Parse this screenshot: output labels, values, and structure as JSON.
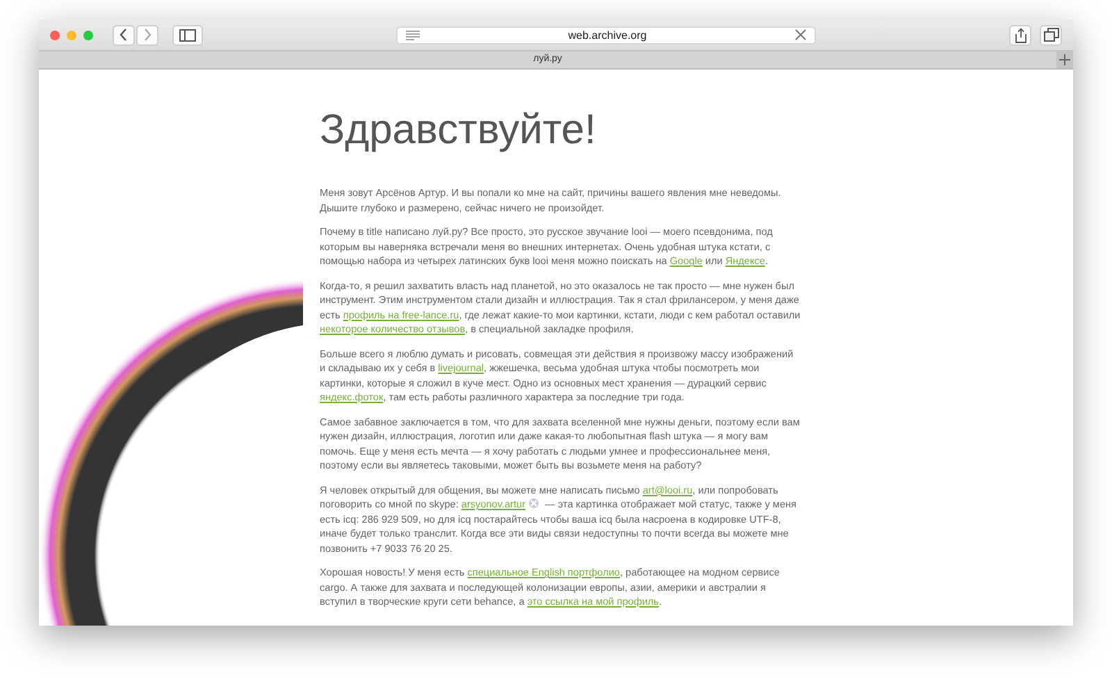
{
  "window": {
    "address": "web.archive.org",
    "tab_title": "луй.ру"
  },
  "page": {
    "heading": "Здравствуйте!",
    "paragraphs": [
      [
        {
          "kind": "text",
          "text": "Меня зовут Арсёнов Артур. И вы попали ко мне на сайт, причины вашего явления мне неведомы. Дышите глубоко и размерено, сейчас ничего не произойдет."
        }
      ],
      [
        {
          "kind": "text",
          "text": "Почему в title написано луй.ру? Все просто, это русское звучание looi — моего псевдонима, под которым вы наверняка встречали меня во внешних интернетах. Очень удобная штука кстати, с помощью набора из четырех латинских букв looi меня можно поискать на "
        },
        {
          "kind": "link",
          "text": "Google"
        },
        {
          "kind": "text",
          "text": " или "
        },
        {
          "kind": "link",
          "text": "Яндексе"
        },
        {
          "kind": "text",
          "text": "."
        }
      ],
      [
        {
          "kind": "text",
          "text": "Когда-то, я решил захватить власть над планетой, но это оказалось не так просто — мне нужен был инструмент. Этим инструментом стали дизайн и иллюстрация. Так я стал фрилансером, у меня даже есть "
        },
        {
          "kind": "link",
          "text": "профиль на free-lance.ru"
        },
        {
          "kind": "text",
          "text": ", где лежат какие-то мои картинки, кстати, люди с кем работал оставили "
        },
        {
          "kind": "link",
          "text": "некоторое количество отзывов"
        },
        {
          "kind": "text",
          "text": ", в специальной закладке профиля."
        }
      ],
      [
        {
          "kind": "text",
          "text": "Больше всего я люблю думать и рисовать, совмещая эти действия я произвожу массу изображений и складываю их у себя в "
        },
        {
          "kind": "link",
          "text": "livejournal"
        },
        {
          "kind": "text",
          "text": ", жжешечка, весьма удобная штука чтобы посмотреть мои картинки, которые я сложил в куче мест. Одно из основных мест хранения — дурацкий сервис "
        },
        {
          "kind": "link",
          "text": "яндекс.фоток"
        },
        {
          "kind": "text",
          "text": ", там есть работы различного характера за последние три года."
        }
      ],
      [
        {
          "kind": "text",
          "text": "Самое забавное заключается в том, что для захвата вселенной мне нужны деньги, поэтому если вам нужен дизайн, иллюстрация, логотип или даже какая-то любопытная flash штука — я могу вам помочь. Еще у меня есть мечта — я хочу работать с людьми умнее и профессиональнее меня, поэтому если вы являетесь таковыми, может быть вы возьмете меня на работу?"
        }
      ],
      [
        {
          "kind": "text",
          "text": "Я человек открытый для общения, вы можете мне написать письмо "
        },
        {
          "kind": "link",
          "text": "art@looi.ru"
        },
        {
          "kind": "text",
          "text": ", или попробовать поговорить со мной по skype: "
        },
        {
          "kind": "link",
          "text": "arsyonov.artur"
        },
        {
          "kind": "status-icon"
        },
        {
          "kind": "text",
          "text": " — эта картинка отображает мой статус, также у меня есть icq: 286 929 509, но для icq постарайтесь чтобы ваша icq была насроена в кодировке UTF-8, иначе будет только транслит. Когда все эти виды связи недоступны то почти всегда вы можете мне позвонить +7 9033 76 20 25."
        }
      ],
      [
        {
          "kind": "text",
          "text": "Хорошая новость! У меня есть "
        },
        {
          "kind": "link",
          "text": "специальное English портфолио"
        },
        {
          "kind": "text",
          "text": ", работающее на модном сервисе cargo. А также для захвата и последующей колонизации европы, азии, америки и австралии я вступил в творческие круги сети behance, а "
        },
        {
          "kind": "link",
          "text": "это ссылка на мой профиль"
        },
        {
          "kind": "text",
          "text": "."
        }
      ]
    ]
  }
}
